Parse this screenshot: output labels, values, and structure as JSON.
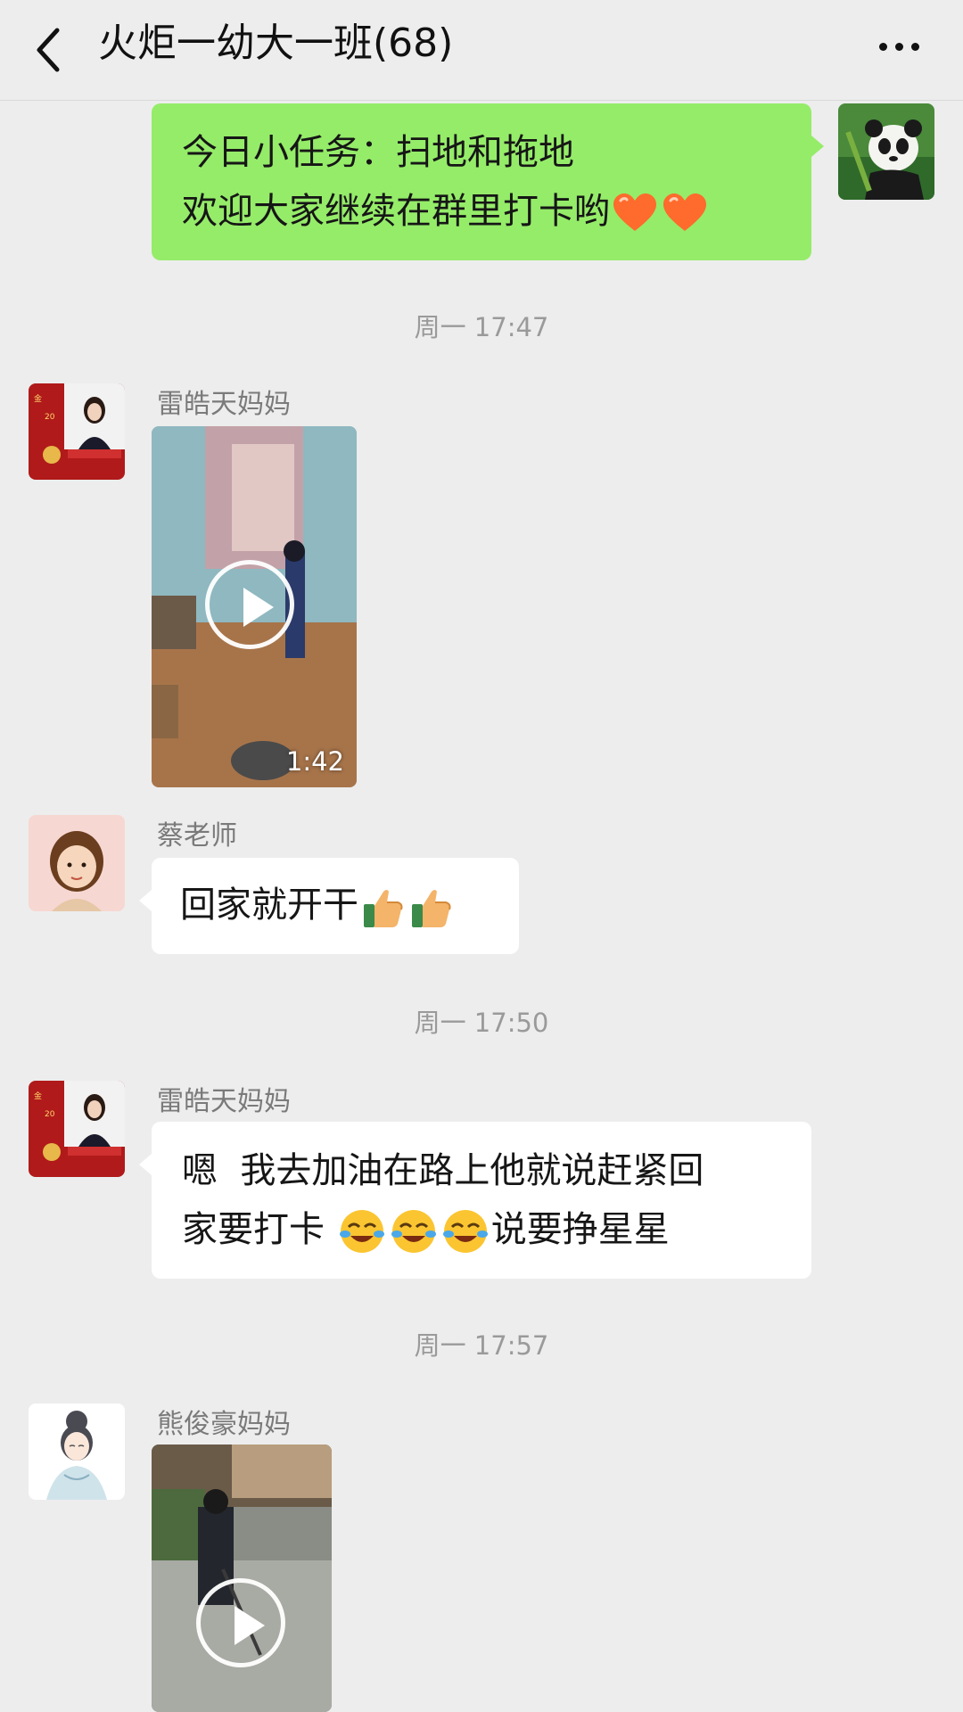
{
  "header": {
    "title": "火炬一幼大一班(68)",
    "back_icon": "chevron-left-icon",
    "more_icon": "ellipsis-icon"
  },
  "messages": [
    {
      "type": "text",
      "side": "right",
      "lines": [
        "今日小任务：扫地和拖地",
        "欢迎大家继续在群里打卡哟"
      ],
      "emoji": [
        "heart-icon",
        "heart-icon"
      ],
      "avatar": "panda-avatar"
    },
    {
      "type": "time",
      "text": "周一 17:47"
    },
    {
      "type": "video",
      "side": "left",
      "sender": "雷皓天妈妈",
      "duration": "1:42"
    },
    {
      "type": "text",
      "side": "left",
      "sender": "蔡老师",
      "text": "回家就开干",
      "emoji": [
        "thumbs-up-icon",
        "thumbs-up-icon"
      ]
    },
    {
      "type": "time",
      "text": "周一 17:50"
    },
    {
      "type": "text",
      "side": "left",
      "sender": "雷皓天妈妈",
      "line1": "嗯  我去加油在路上他就说赶紧回",
      "line2a": "家要打卡 ",
      "line2b": "说要挣星星",
      "emoji": [
        "laughing-tears-icon",
        "laughing-tears-icon",
        "laughing-tears-icon"
      ]
    },
    {
      "type": "time",
      "text": "周一 17:57"
    },
    {
      "type": "video",
      "side": "left",
      "sender": "熊俊豪妈妈"
    }
  ],
  "colors": {
    "background": "#ededed",
    "own_bubble": "#95ec69",
    "other_bubble": "#ffffff",
    "time_text": "#9a9a9a"
  }
}
